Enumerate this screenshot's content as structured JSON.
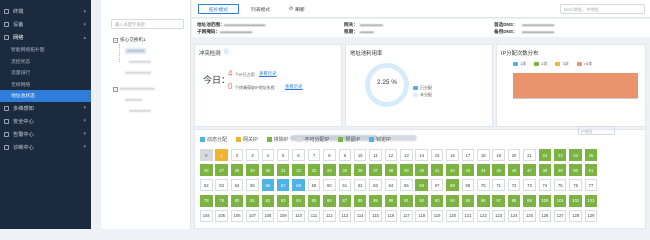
{
  "nav": {
    "items": [
      {
        "label": "终端",
        "icon": "terminal-icon"
      },
      {
        "label": "设备",
        "icon": "device-icon"
      },
      {
        "label": "网络",
        "icon": "network-icon",
        "open": true
      }
    ],
    "sub_items": [
      "智能网络拓扑图",
      "流控状态",
      "流量排行",
      "无线网络",
      "地址池状态"
    ],
    "items_after": [
      {
        "label": "多维感知",
        "icon": "sense-icon"
      },
      {
        "label": "安全中心",
        "icon": "shield-icon"
      },
      {
        "label": "告警中心",
        "icon": "bell-icon"
      },
      {
        "label": "诊断中心",
        "icon": "diagnose-icon"
      }
    ]
  },
  "tree": {
    "search_placeholder": "输入关键字搜索",
    "root_label": "核心交换机1"
  },
  "topbar": {
    "topo_label": "拓扑模式",
    "list_label": "列表模式",
    "refresh_label": "刷新",
    "mac_placeholder": "MAC地址、IP地址"
  },
  "info": {
    "pool_key": "地址池范围：",
    "mask_key": "子网掩码：",
    "gw_key": "网关：",
    "lease_key": "租期：",
    "dns1_key": "首选DNS：",
    "dns2_key": "备用DNS："
  },
  "conflict": {
    "title": "冲突检测",
    "today_label": "今日：",
    "count1": "4",
    "label1": "个IP已占用",
    "history1": "查看历史",
    "count2": "0",
    "label2": "个终端获取IP地址失败",
    "history2": "查看历史"
  },
  "usage": {
    "title": "地址池利用率",
    "percent": "2.25 %",
    "legend": [
      "已分配",
      "未分配"
    ]
  },
  "dist": {
    "title": "IP分配次数分布",
    "legend": [
      "1次",
      "2次",
      "3次",
      ">3次"
    ],
    "colors": [
      "#4fb3e8",
      "#7cb342",
      "#f0b432",
      "#e9946d"
    ]
  },
  "ip_legend": [
    {
      "label": "动态分配",
      "color": "#4fb3e8"
    },
    {
      "label": "网关IP",
      "color": "#f0b432"
    },
    {
      "label": "排除IP",
      "color": "#7cb342"
    },
    {
      "label": "不可分配IP",
      "color": "#d7d9dc"
    },
    {
      "label": "预留IP",
      "color": "#7cb342"
    },
    {
      "label": "锁定IP",
      "color": "#4fb3e8"
    }
  ],
  "ip_filter_placeholder": "IP地址",
  "ip_rows": [
    [
      [
        "0",
        "gr"
      ],
      [
        "1",
        "y"
      ],
      [
        "2",
        ""
      ],
      [
        "3",
        ""
      ],
      [
        "4",
        ""
      ],
      [
        "5",
        ""
      ],
      [
        "6",
        ""
      ],
      [
        "7",
        ""
      ],
      [
        "8",
        ""
      ],
      [
        "9",
        ""
      ],
      [
        "10",
        ""
      ],
      [
        "11",
        ""
      ],
      [
        "12",
        ""
      ],
      [
        "13",
        ""
      ],
      [
        "14",
        ""
      ],
      [
        "15",
        ""
      ],
      [
        "16",
        ""
      ],
      [
        "17",
        ""
      ],
      [
        "18",
        ""
      ],
      [
        "19",
        ""
      ],
      [
        "20",
        ""
      ],
      [
        "21",
        ""
      ],
      [
        "22",
        "g"
      ],
      [
        "23",
        "g"
      ],
      [
        "24",
        "g"
      ],
      [
        "25",
        "g"
      ]
    ],
    [
      [
        "26",
        "g"
      ],
      [
        "27",
        "g"
      ],
      [
        "28",
        "g"
      ],
      [
        "29",
        "g"
      ],
      [
        "30",
        "g"
      ],
      [
        "31",
        "g"
      ],
      [
        "32",
        "g"
      ],
      [
        "33",
        "g"
      ],
      [
        "34",
        "g"
      ],
      [
        "35",
        "g"
      ],
      [
        "36",
        "g"
      ],
      [
        "37",
        "g"
      ],
      [
        "38",
        "g"
      ],
      [
        "39",
        "g"
      ],
      [
        "40",
        "g"
      ],
      [
        "41",
        "g"
      ],
      [
        "42",
        "g"
      ],
      [
        "43",
        "g"
      ],
      [
        "44",
        "g"
      ],
      [
        "45",
        "g"
      ],
      [
        "46",
        "g"
      ],
      [
        "47",
        "g"
      ],
      [
        "48",
        "g"
      ],
      [
        "49",
        "g"
      ],
      [
        "50",
        "g"
      ],
      [
        "51",
        "g"
      ]
    ],
    [
      [
        "52",
        ""
      ],
      [
        "53",
        ""
      ],
      [
        "54",
        ""
      ],
      [
        "55",
        ""
      ],
      [
        "56",
        "b"
      ],
      [
        "57",
        "b"
      ],
      [
        "58",
        "b"
      ],
      [
        "59",
        ""
      ],
      [
        "60",
        ""
      ],
      [
        "61",
        ""
      ],
      [
        "62",
        ""
      ],
      [
        "63",
        ""
      ],
      [
        "64",
        ""
      ],
      [
        "65",
        ""
      ],
      [
        "66",
        "g"
      ],
      [
        "67",
        ""
      ],
      [
        "68",
        "g"
      ],
      [
        "69",
        ""
      ],
      [
        "70",
        ""
      ],
      [
        "71",
        ""
      ],
      [
        "72",
        ""
      ],
      [
        "73",
        ""
      ],
      [
        "74",
        ""
      ],
      [
        "75",
        ""
      ],
      [
        "76",
        ""
      ],
      [
        "77",
        ""
      ]
    ],
    [
      [
        "78",
        "g"
      ],
      [
        "79",
        "g"
      ],
      [
        "80",
        "g"
      ],
      [
        "81",
        "g"
      ],
      [
        "82",
        "g"
      ],
      [
        "83",
        "g"
      ],
      [
        "84",
        "g"
      ],
      [
        "85",
        "g"
      ],
      [
        "86",
        "g"
      ],
      [
        "87",
        "g"
      ],
      [
        "88",
        "g"
      ],
      [
        "89",
        "g"
      ],
      [
        "90",
        "g"
      ],
      [
        "91",
        "g"
      ],
      [
        "92",
        "g"
      ],
      [
        "93",
        "g"
      ],
      [
        "94",
        "g"
      ],
      [
        "95",
        "g"
      ],
      [
        "96",
        "g"
      ],
      [
        "97",
        "g"
      ],
      [
        "98",
        "g"
      ],
      [
        "99",
        "g"
      ],
      [
        "100",
        "g"
      ],
      [
        "101",
        "g"
      ],
      [
        "102",
        "g"
      ],
      [
        "103",
        "g"
      ]
    ],
    [
      [
        "104",
        ""
      ],
      [
        "105",
        ""
      ],
      [
        "106",
        ""
      ],
      [
        "107",
        ""
      ],
      [
        "108",
        ""
      ],
      [
        "109",
        ""
      ],
      [
        "110",
        ""
      ],
      [
        "111",
        ""
      ],
      [
        "112",
        ""
      ],
      [
        "113",
        ""
      ],
      [
        "114",
        ""
      ],
      [
        "115",
        ""
      ],
      [
        "116",
        ""
      ],
      [
        "117",
        ""
      ],
      [
        "118",
        ""
      ],
      [
        "119",
        ""
      ],
      [
        "120",
        ""
      ],
      [
        "121",
        ""
      ],
      [
        "122",
        ""
      ],
      [
        "123",
        ""
      ],
      [
        "124",
        ""
      ],
      [
        "125",
        ""
      ],
      [
        "126",
        ""
      ],
      [
        "127",
        ""
      ],
      [
        "128",
        ""
      ],
      [
        "129",
        ""
      ]
    ]
  ]
}
